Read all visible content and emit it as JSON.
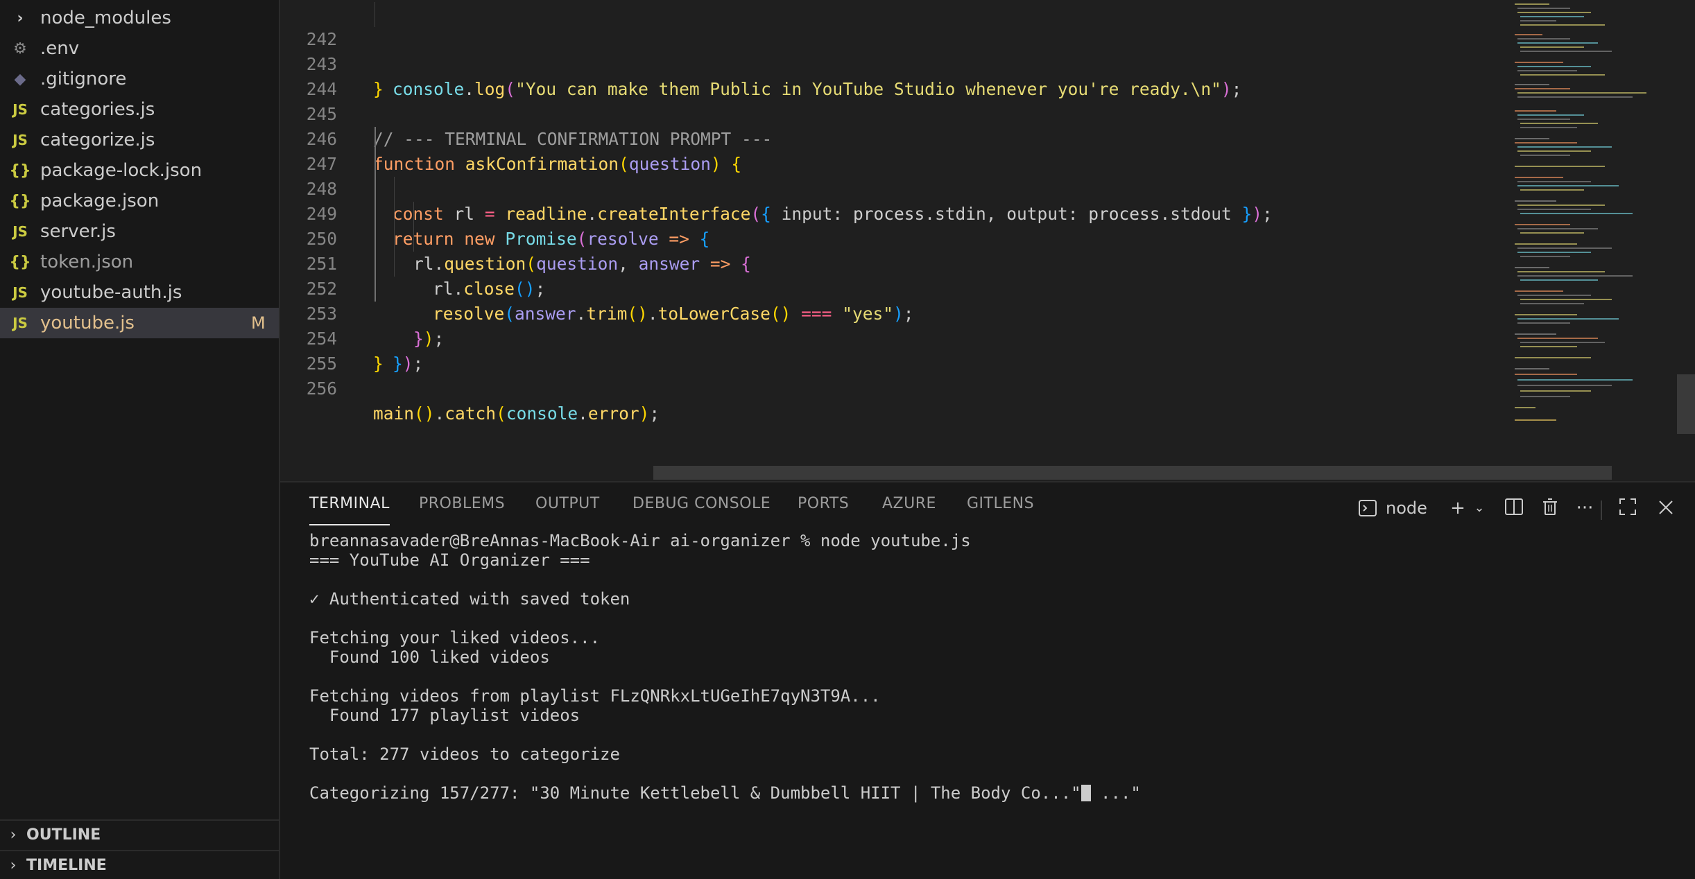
{
  "explorer": {
    "files": [
      {
        "name": "node_modules",
        "icon": "chevron-right-icon",
        "badge": ""
      },
      {
        "name": ".env",
        "icon": "gear-icon",
        "badge": ""
      },
      {
        "name": ".gitignore",
        "icon": "git-icon",
        "badge": ""
      },
      {
        "name": "categories.js",
        "icon": "js-icon",
        "badge": ""
      },
      {
        "name": "categorize.js",
        "icon": "js-icon",
        "badge": ""
      },
      {
        "name": "package-lock.json",
        "icon": "json-icon",
        "badge": ""
      },
      {
        "name": "package.json",
        "icon": "json-icon",
        "badge": ""
      },
      {
        "name": "server.js",
        "icon": "js-icon",
        "badge": ""
      },
      {
        "name": "token.json",
        "icon": "json-icon",
        "badge": ""
      },
      {
        "name": "youtube-auth.js",
        "icon": "js-icon",
        "badge": ""
      },
      {
        "name": "youtube.js",
        "icon": "js-icon",
        "badge": "M"
      }
    ],
    "sections": [
      "OUTLINE",
      "TIMELINE"
    ]
  },
  "editor": {
    "line_numbers": [
      "242",
      "243",
      "244",
      "245",
      "246",
      "247",
      "248",
      "249",
      "250",
      "251",
      "252",
      "253",
      "254",
      "255",
      "256"
    ]
  },
  "panel": {
    "tabs": [
      "TERMINAL",
      "PROBLEMS",
      "OUTPUT",
      "DEBUG CONSOLE",
      "PORTS",
      "AZURE",
      "GITLENS"
    ],
    "terminal_name": "node",
    "terminal_lines": [
      "breannasavader@BreAnnas-MacBook-Air ai-organizer % node youtube.js",
      "=== YouTube AI Organizer ===",
      "",
      "✓ Authenticated with saved token",
      "",
      "Fetching your liked videos...",
      "  Found 100 liked videos",
      "",
      "Fetching videos from playlist FLzQNRkxLtUGeIhE7qyN3T9A...",
      "  Found 177 playlist videos",
      "",
      "Total: 277 videos to categorize",
      ""
    ],
    "progress_line_before_cursor": "Categorizing 157/277: \"30 Minute Kettlebell & Dumbbell HIIT | The Body Co...\"",
    "progress_line_after_cursor": " ...\""
  },
  "icons": {
    "terminal": "terminal-icon",
    "add": "plus-icon",
    "dropdown": "chevron-down-icon",
    "split": "split-terminal-icon",
    "trash": "trash-icon",
    "more": "more-actions-icon",
    "maximize": "maximize-panel-icon",
    "close": "close-icon"
  }
}
